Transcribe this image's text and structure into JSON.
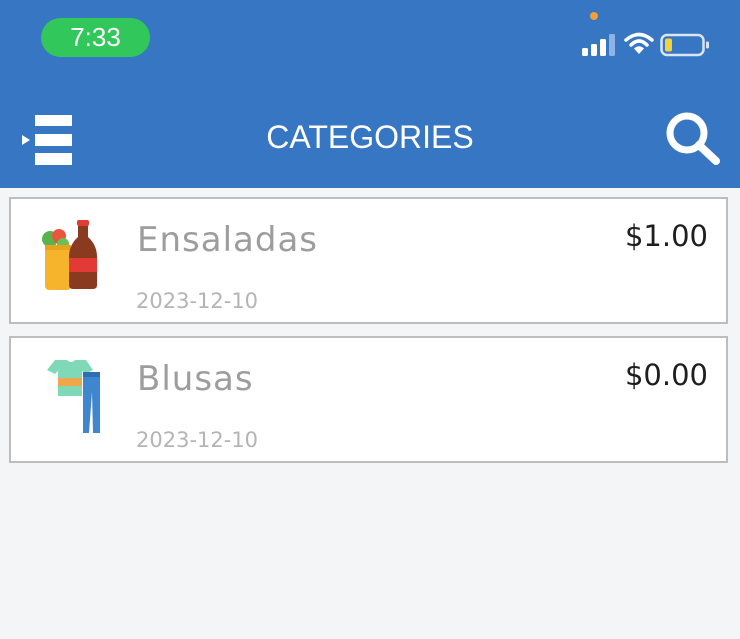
{
  "status_bar": {
    "time": "7:33",
    "signal_icon": "cellular-signal-icon",
    "wifi_icon": "wifi-icon",
    "battery_icon": "battery-low-icon",
    "privacy_dot_color": "#f29f38"
  },
  "header": {
    "title": "CATEGORIES",
    "menu_icon": "hamburger-menu-icon",
    "search_icon": "search-icon",
    "background_color": "#3776c2"
  },
  "categories": [
    {
      "name": "Ensaladas",
      "date": "2023-12-10",
      "price": "$1.00",
      "icon": "groceries-icon"
    },
    {
      "name": "Blusas",
      "date": "2023-12-10",
      "price": "$0.00",
      "icon": "clothing-icon"
    }
  ]
}
